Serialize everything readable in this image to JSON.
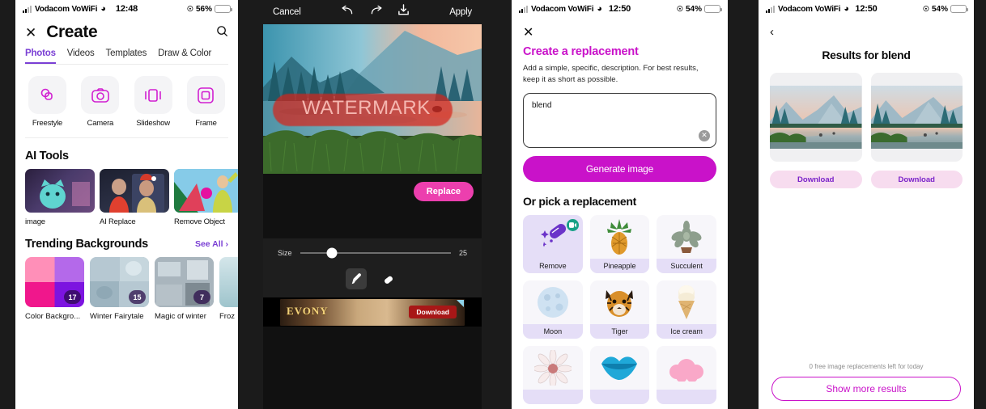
{
  "panels": {
    "create": {
      "status": {
        "carrier": "Vodacom VoWiFi",
        "time": "12:48",
        "battery": "56%",
        "wifi_icon": "wifi-icon",
        "lock_icon": "lock-rotation-icon"
      },
      "close_icon": "close-icon",
      "title": "Create",
      "search_icon": "search-icon",
      "tabs": [
        {
          "label": "Photos",
          "active": true
        },
        {
          "label": "Videos",
          "active": false
        },
        {
          "label": "Templates",
          "active": false
        },
        {
          "label": "Draw & Color",
          "active": false
        }
      ],
      "tools": [
        {
          "label": "Freestyle",
          "icon": "freestyle-shapes-icon"
        },
        {
          "label": "Camera",
          "icon": "camera-icon"
        },
        {
          "label": "Slideshow",
          "icon": "slideshow-icon"
        },
        {
          "label": "Frame",
          "icon": "frame-icon"
        }
      ],
      "ai_tools_title": "AI Tools",
      "ai_tools": [
        {
          "label": "image",
          "thumb": "ai-cat-thumbnail"
        },
        {
          "label": "AI Replace",
          "thumb": "ai-replace-thumbnail"
        },
        {
          "label": "Remove Object",
          "thumb": "remove-object-thumbnail"
        }
      ],
      "trending_title": "Trending Backgrounds",
      "see_all": "See All",
      "see_all_icon": "chevron-right-icon",
      "backgrounds": [
        {
          "label": "Color Backgro...",
          "count": "17"
        },
        {
          "label": "Winter Fairytale",
          "count": "15"
        },
        {
          "label": "Magic of winter",
          "count": "7"
        },
        {
          "label": "Froz",
          "count": ""
        }
      ]
    },
    "editor": {
      "cancel_label": "Cancel",
      "undo_icon": "undo-arrow-icon",
      "redo_icon": "redo-arrow-icon",
      "download_icon": "download-icon",
      "apply_label": "Apply",
      "watermark_text": "WATERMARK",
      "replace_label": "Replace",
      "size_label": "Size",
      "size_value": "25",
      "size_percent": 21,
      "brush_icon": "paintbrush-icon",
      "eraser_icon": "eraser-icon",
      "ad": {
        "brand": "EVONY",
        "cta": "Download",
        "ad_marker_icon": "ad-choices-icon"
      }
    },
    "replacement": {
      "status": {
        "carrier": "Vodacom VoWiFi",
        "time": "12:50",
        "battery": "54%"
      },
      "close_icon": "close-icon",
      "title": "Create a replacement",
      "subtitle": "Add a simple, specific, description. For best results, keep it as short as possible.",
      "prompt_value": "blend",
      "clear_icon": "clear-text-icon",
      "generate_label": "Generate image",
      "pick_title": "Or pick a replacement",
      "items": [
        {
          "label": "Remove",
          "icon": "magic-eraser-icon",
          "accent": true,
          "badge": "video-badge-icon"
        },
        {
          "label": "Pineapple",
          "icon": "pineapple-icon",
          "accent": false,
          "badge": ""
        },
        {
          "label": "Succulent",
          "icon": "succulent-plant-icon",
          "accent": false,
          "badge": ""
        },
        {
          "label": "Moon",
          "icon": "moon-icon",
          "accent": false,
          "badge": ""
        },
        {
          "label": "Tiger",
          "icon": "tiger-face-icon",
          "accent": false,
          "badge": ""
        },
        {
          "label": "Ice cream",
          "icon": "ice-cream-cone-icon",
          "accent": false,
          "badge": ""
        },
        {
          "label": "",
          "icon": "daisy-flower-icon",
          "accent": false,
          "badge": ""
        },
        {
          "label": "",
          "icon": "blue-lips-icon",
          "accent": false,
          "badge": ""
        },
        {
          "label": "",
          "icon": "pink-fluff-icon",
          "accent": false,
          "badge": ""
        }
      ]
    },
    "results": {
      "status": {
        "carrier": "Vodacom VoWiFi",
        "time": "12:50",
        "battery": "54%"
      },
      "back_icon": "back-chevron-icon",
      "title": "Results for blend",
      "cards": [
        {
          "download_label": "Download",
          "image": "landscape-sunset-lake-1"
        },
        {
          "download_label": "Download",
          "image": "landscape-sunset-lake-2"
        }
      ],
      "quota_text": "0 free image replacements left for today",
      "show_more_label": "Show more results"
    }
  },
  "colors": {
    "accent_purple": "#7a3fd4",
    "accent_magenta": "#c912c9",
    "pink": "#ec3fae",
    "dark": "#1b1b1b"
  }
}
